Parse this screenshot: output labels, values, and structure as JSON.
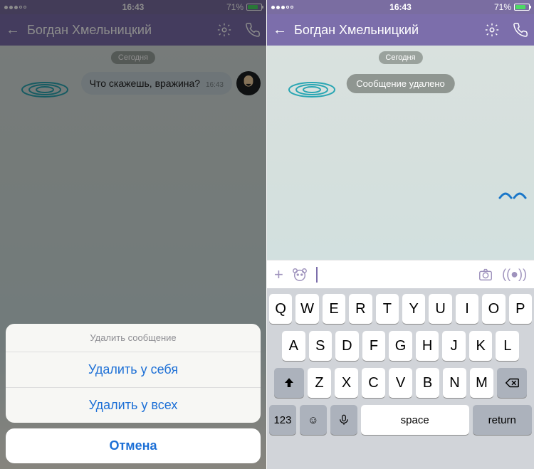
{
  "status": {
    "time": "16:43",
    "battery_pct": "71%"
  },
  "header": {
    "contact_name": "Богдан Хмельницкий"
  },
  "left": {
    "day_label": "Сегодня",
    "message_text": "Что скажешь, вражина?",
    "message_time": "16:43",
    "sheet": {
      "title": "Удалить сообщение",
      "delete_for_me": "Удалить у себя",
      "delete_for_all": "Удалить у всех",
      "cancel": "Отмена"
    }
  },
  "right": {
    "day_label": "Сегодня",
    "deleted_label": "Сообщение удалено",
    "keyboard": {
      "row1": [
        "Q",
        "W",
        "E",
        "R",
        "T",
        "Y",
        "U",
        "I",
        "O",
        "P"
      ],
      "row2": [
        "A",
        "S",
        "D",
        "F",
        "G",
        "H",
        "J",
        "K",
        "L"
      ],
      "row3": [
        "Z",
        "X",
        "C",
        "V",
        "B",
        "N",
        "M"
      ],
      "num_label": "123",
      "space_label": "space",
      "return_label": "return"
    }
  }
}
